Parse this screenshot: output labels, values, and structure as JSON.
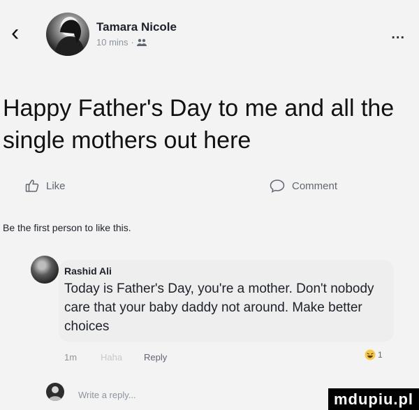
{
  "header": {
    "back_icon": "chevron-left-icon",
    "author_name": "Tamara Nicole",
    "time": "10 mins",
    "separator": "·",
    "audience_icon": "friends-icon",
    "more_label": "..."
  },
  "post": {
    "text": "Happy Father's Day to me and all the single mothers out here"
  },
  "actions": {
    "like_label": "Like",
    "like_icon": "thumbs-up-icon",
    "comment_label": "Comment",
    "comment_icon": "speech-bubble-icon"
  },
  "first_like_text": "Be the first person to like this.",
  "comment": {
    "name": "Rashid Ali",
    "text": "Today is Father's Day, you're a mother. Don't nobody care that your baby daddy not around. Make better choices",
    "time": "1m",
    "haha_label": "Haha",
    "reply_label": "Reply",
    "reaction_icon": "haha-emoji-icon",
    "reaction_count": "1"
  },
  "write_reply": {
    "placeholder": "Write a reply..."
  },
  "watermark": "mdupiu.pl",
  "colors": {
    "background": "#f3f3f3",
    "bubble": "#eeeeee",
    "secondary_text": "#8d949e",
    "reaction_yellow": "#f7c94b"
  }
}
